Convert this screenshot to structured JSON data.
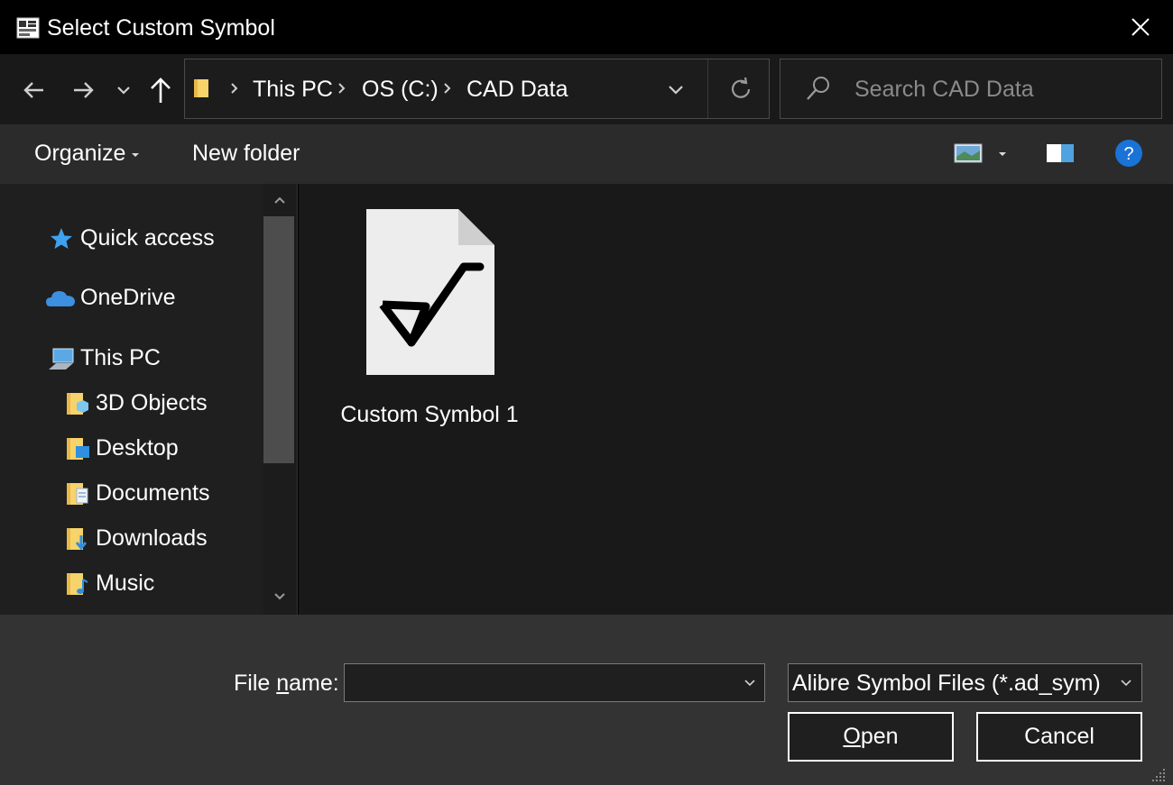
{
  "window": {
    "title": "Select Custom Symbol",
    "title_icon": "dialog-app-icon",
    "close_icon": "close-icon"
  },
  "nav": {
    "back_icon": "arrow-left-icon",
    "forward_icon": "arrow-right-icon",
    "recent_icon": "chevron-down-icon",
    "up_icon": "arrow-up-icon"
  },
  "address": {
    "crumbs": [
      "This PC",
      "OS (C:)",
      "CAD Data"
    ],
    "refresh_icon": "refresh-icon"
  },
  "search": {
    "placeholder": "Search CAD Data",
    "value": ""
  },
  "toolbar": {
    "organize_label": "Organize",
    "new_folder_label": "New folder",
    "view_icon": "view-options-icon",
    "preview_pane_icon": "preview-pane-icon",
    "help_icon": "help-icon"
  },
  "sidebar": {
    "items": [
      {
        "label": "Quick access",
        "icon": "star-icon"
      },
      {
        "label": "OneDrive",
        "icon": "cloud-icon"
      },
      {
        "label": "This PC",
        "icon": "computer-icon"
      },
      {
        "label": "3D Objects",
        "icon": "3d-objects-folder-icon"
      },
      {
        "label": "Desktop",
        "icon": "desktop-folder-icon"
      },
      {
        "label": "Documents",
        "icon": "documents-folder-icon"
      },
      {
        "label": "Downloads",
        "icon": "downloads-folder-icon"
      },
      {
        "label": "Music",
        "icon": "music-folder-icon"
      }
    ]
  },
  "files": [
    {
      "name": "Custom Symbol 1",
      "icon": "symbol-file-icon"
    }
  ],
  "footer": {
    "file_name_prefix": "File ",
    "file_name_accel": "n",
    "file_name_suffix": "ame:",
    "file_name_value": "",
    "filter_value": "Alibre Symbol Files (*.ad_sym)",
    "open_accel": "O",
    "open_rest": "pen",
    "cancel_label": "Cancel"
  },
  "colors": {
    "titlebar_bg": "#000000",
    "navbar_bg": "#191919",
    "cmdbar_bg": "#2b2b2b",
    "footer_bg": "#333333",
    "accent_blue": "#1a73d6"
  }
}
